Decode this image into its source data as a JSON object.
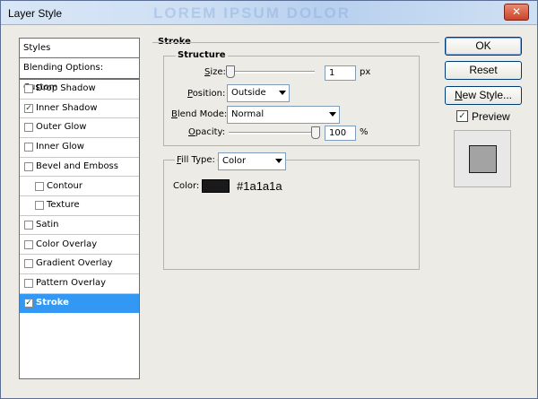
{
  "window": {
    "title": "Layer Style",
    "close_glyph": "✕",
    "background_text": "LOREM IPSUM DOLOR"
  },
  "styles_panel": {
    "header": "Styles",
    "blending_options": "Blending Options: Custom",
    "items": [
      {
        "label": "Drop Shadow",
        "checked": false,
        "indent": false,
        "selected": false
      },
      {
        "label": "Inner Shadow",
        "checked": true,
        "indent": false,
        "selected": false
      },
      {
        "label": "Outer Glow",
        "checked": false,
        "indent": false,
        "selected": false
      },
      {
        "label": "Inner Glow",
        "checked": false,
        "indent": false,
        "selected": false
      },
      {
        "label": "Bevel and Emboss",
        "checked": false,
        "indent": false,
        "selected": false
      },
      {
        "label": "Contour",
        "checked": false,
        "indent": true,
        "selected": false
      },
      {
        "label": "Texture",
        "checked": false,
        "indent": true,
        "selected": false
      },
      {
        "label": "Satin",
        "checked": false,
        "indent": false,
        "selected": false
      },
      {
        "label": "Color Overlay",
        "checked": false,
        "indent": false,
        "selected": false
      },
      {
        "label": "Gradient Overlay",
        "checked": false,
        "indent": false,
        "selected": false
      },
      {
        "label": "Pattern Overlay",
        "checked": false,
        "indent": false,
        "selected": false
      },
      {
        "label": "Stroke",
        "checked": true,
        "indent": false,
        "selected": true
      }
    ]
  },
  "stroke": {
    "title": "Stroke",
    "structure_title": "Structure",
    "size_label_u": "S",
    "size_label_rest": "ize:",
    "size_value": "1",
    "size_unit": "px",
    "size_fraction": 0.0,
    "position_label_u": "P",
    "position_label_rest": "osition:",
    "position_value": "Outside",
    "blend_label_u": "B",
    "blend_label_rest": "lend Mode:",
    "blend_value": "Normal",
    "opacity_label_u": "O",
    "opacity_label_rest": "pacity:",
    "opacity_value": "100",
    "opacity_unit": "%",
    "opacity_fraction": 1.0,
    "fill_type_label_u": "F",
    "fill_type_label_rest": "ill Type:",
    "fill_type_value": "Color",
    "color_label": "Color:",
    "color_value": "#1a1a1a"
  },
  "buttons": {
    "ok": "OK",
    "reset": "Reset",
    "new_style": "New Style...",
    "new_style_u": "N",
    "new_style_rest": "ew Style...",
    "preview_label": "Preview",
    "preview_checked": true
  },
  "colors": {
    "selection": "#3398f3",
    "stroke_color": "#1a1a1a"
  }
}
